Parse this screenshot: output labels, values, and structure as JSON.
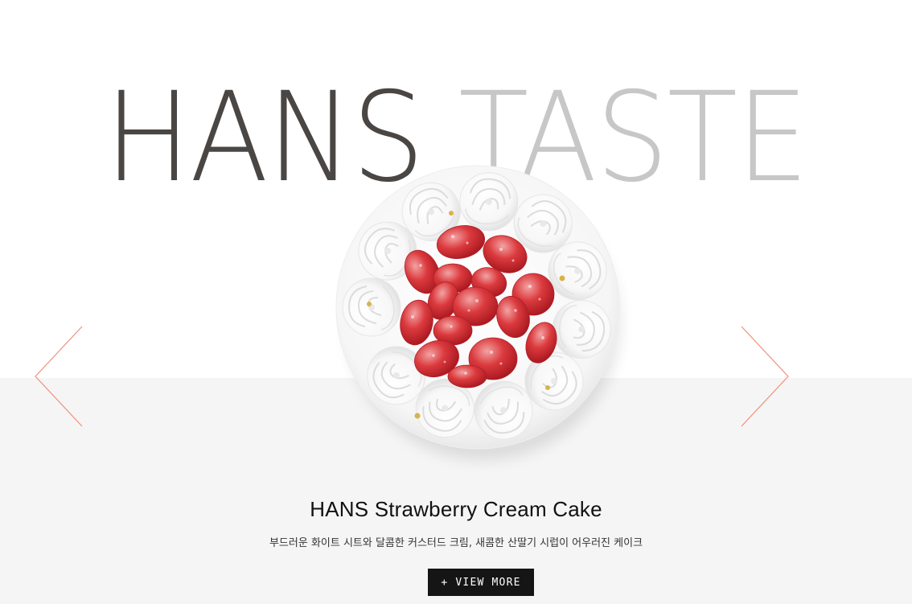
{
  "hero": {
    "word1": "HANS",
    "word2": "TASTE"
  },
  "product": {
    "title": "HANS Strawberry Cream Cake",
    "description": "부드러운 화이트 시트와 달콤한 커스터드 크림, 새콤한 산딸기 시럽이 어우러진 케이크",
    "button_label": "+ VIEW MORE"
  },
  "nav": {
    "prev_icon": "chevron-left-icon",
    "next_icon": "chevron-right-icon"
  },
  "colors": {
    "hero_word1": "#4a4644",
    "hero_word2": "#c7c7c7",
    "arrow": "#f0907a",
    "band": "#f5f5f5",
    "button_bg": "#151515"
  }
}
